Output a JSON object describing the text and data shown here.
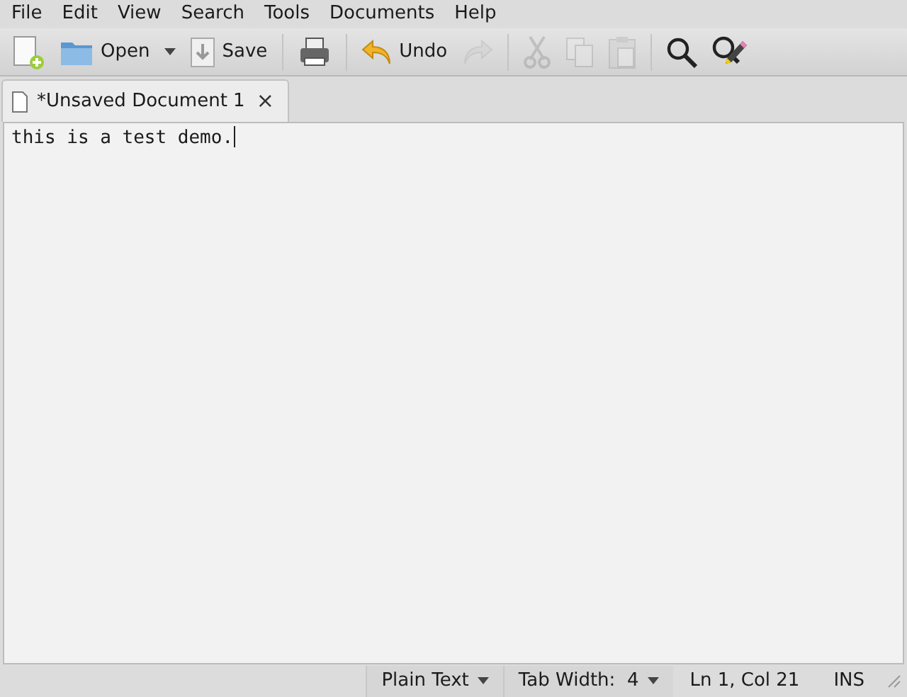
{
  "menu": [
    "File",
    "Edit",
    "View",
    "Search",
    "Tools",
    "Documents",
    "Help"
  ],
  "toolbar": [
    {
      "kind": "button",
      "disabled": false
    },
    {
      "kind": "button",
      "label": "Open",
      "disabled": false,
      "dropdown": true
    },
    {
      "kind": "button",
      "label": "Save",
      "disabled": false
    },
    {
      "kind": "separator"
    },
    {
      "kind": "button",
      "disabled": false
    },
    {
      "kind": "separator"
    },
    {
      "kind": "button",
      "label": "Undo",
      "disabled": false
    },
    {
      "kind": "button",
      "disabled": true
    },
    {
      "kind": "separator"
    },
    {
      "kind": "button",
      "disabled": true
    },
    {
      "kind": "button",
      "disabled": true
    },
    {
      "kind": "button",
      "disabled": true
    },
    {
      "kind": "separator"
    },
    {
      "kind": "button",
      "disabled": false
    },
    {
      "kind": "button",
      "disabled": false
    }
  ],
  "tabs": [
    {
      "label": "*Unsaved Document 1",
      "selected": true,
      "close": "×"
    }
  ],
  "editor": {
    "text": "this is a test demo."
  },
  "status_bar": [
    {
      "kind": "dropdown",
      "text": "Plain Text"
    },
    {
      "kind": "dropdown",
      "text": "Tab Width:  4"
    },
    {
      "kind": "text",
      "text": "Ln 1, Col 21"
    },
    {
      "kind": "text",
      "text": "INS"
    }
  ]
}
